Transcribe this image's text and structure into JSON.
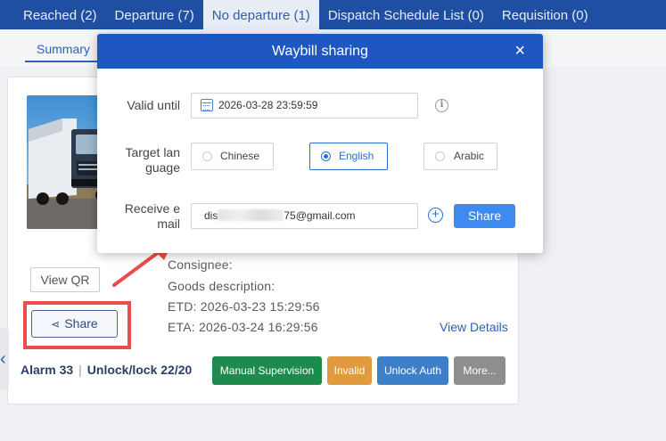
{
  "top_tabs": [
    {
      "label": "Reached (2)"
    },
    {
      "label": "Departure (7)"
    },
    {
      "label": "No departure (1)"
    },
    {
      "label": "Dispatch Schedule List (0)"
    },
    {
      "label": "Requisition (0)"
    }
  ],
  "active_top_tab": "No departure (1)",
  "sub_tab": "Summary",
  "card": {
    "view_qr": "View QR",
    "share_label": "Share",
    "consignee": "Consignee:",
    "goods_description": "Goods description:",
    "etd": "ETD:  2026-03-23 15:29:56",
    "eta": "ETA:  2026-03-24 16:29:56",
    "view_details": "View Details",
    "alarm": "Alarm 33",
    "unlock_lock": "Unlock/lock 22/20",
    "actions": {
      "manual_supervision": "Manual Supervision",
      "invalid": "Invalid",
      "unlock_auth": "Unlock Auth",
      "more": "More..."
    }
  },
  "modal": {
    "title": "Waybill sharing",
    "close": "×",
    "valid_until_label": "Valid until",
    "valid_until_value": "2026-03-28 23:59:59",
    "target_language_label_1": "Target lan",
    "target_language_label_2": "guage",
    "languages": [
      "Chinese",
      "English",
      "Arabic"
    ],
    "selected_language": "English",
    "receive_email_label_1": "Receive e",
    "receive_email_label_2": "mail",
    "email_prefix": "dis",
    "email_suffix": "75@gmail.com",
    "share_button": "Share"
  },
  "colors": {
    "top_bar": "#1f4fa3",
    "modal_header": "#1f57c2",
    "highlight": "#ea4d4a",
    "manual_supervision": "#1f8a4e",
    "invalid": "#e19a3e",
    "unlock_auth": "#3e7fca",
    "more": "#8e8e8e"
  },
  "icons": {
    "calendar": "calendar-icon",
    "info": "info-icon",
    "add": "plus-circle-icon",
    "close": "close-icon",
    "share": "share-icon",
    "collapse": "chevron-left-icon"
  }
}
